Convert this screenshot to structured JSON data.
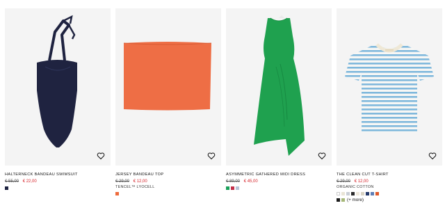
{
  "products": [
    {
      "name": "HALTERNECK BANDEAU SWIMSUIT",
      "old_price": "€ 55,00",
      "sale_price": "€ 22,00",
      "material": "",
      "colors": [
        "#1d2240"
      ],
      "more_colors": [],
      "more_label": "",
      "product_color": "#1f2340"
    },
    {
      "name": "JERSEY BANDEAU TOP",
      "old_price": "€ 29,00",
      "sale_price": "€ 12,00",
      "material": "TENCEL™ LYOCELL",
      "colors": [
        "#ee6b3c"
      ],
      "more_colors": [],
      "more_label": "",
      "product_color": "#ee6e45"
    },
    {
      "name": "ASYMMETRIC GATHERED MIDI DRESS",
      "old_price": "€ 89,00",
      "sale_price": "€ 45,00",
      "material": "",
      "colors": [
        "#1aa05a",
        "#c2304a",
        "#b8c4d8"
      ],
      "more_colors": [],
      "more_label": "",
      "product_color": "#1fa14f"
    },
    {
      "name": "THE CLEAN CUT T-SHIRT",
      "old_price": "€ 29,00",
      "sale_price": "€ 12,00",
      "material": "ORGANIC COTTON",
      "colors": [
        "#ffffff",
        "#e9e4d6",
        "#c9ced6",
        "#2b2b2b",
        "#efe9dc",
        "#d9d3c4",
        "#253a6b",
        "#5f7fb6",
        "#e05a2a"
      ],
      "more_colors": [
        "#1c1c1c",
        "#a6b879"
      ],
      "more_label": "(+ more)",
      "product_color": "#7fb8dc"
    }
  ],
  "icons": {
    "wishlist": "heart-outline-icon"
  }
}
